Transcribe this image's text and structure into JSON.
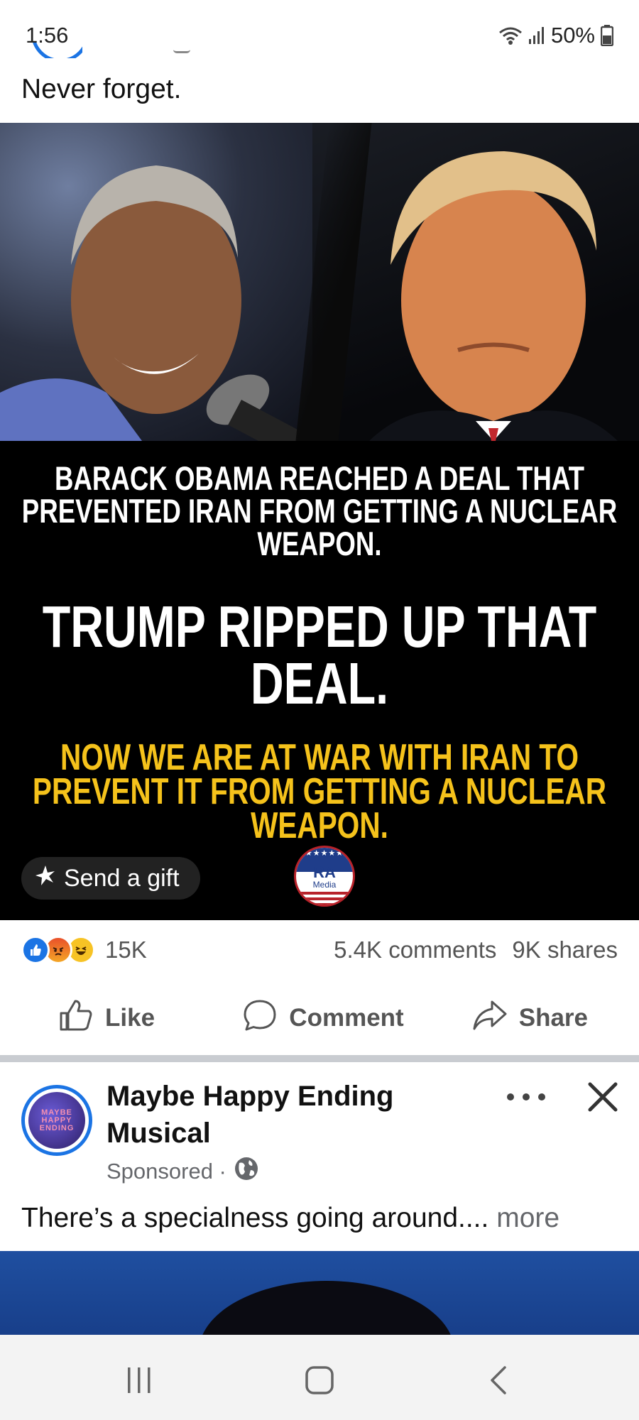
{
  "status_bar": {
    "time": "1:56",
    "battery": "50%"
  },
  "post": {
    "caption": "Never forget.",
    "image": {
      "headline_1": "BARACK OBAMA REACHED A DEAL THAT PREVENTED IRAN FROM GETTING A NUCLEAR WEAPON.",
      "headline_2": "TRUMP RIPPED UP THAT DEAL.",
      "headline_3": "NOW WE ARE AT WAR WITH IRAN TO PREVENT IT FROM GETTING A NUCLEAR WEAPON.",
      "logo_text": "RA",
      "logo_subtext": "Media",
      "logo_stars": "★★★★★"
    },
    "gift_button_label": "Send a gift",
    "reactions": [
      "like",
      "angry",
      "haha"
    ],
    "reaction_count": "15K",
    "comments_count": "5.4K comments",
    "shares_count": "9K shares",
    "actions": {
      "like": "Like",
      "comment": "Comment",
      "share": "Share"
    }
  },
  "sponsored_post": {
    "page_name": "Maybe Happy Ending Musical",
    "avatar_lines": [
      "MAYBE",
      "HAPPY",
      "ENDING"
    ],
    "meta": "Sponsored ·",
    "text": "There’s a specialness going around....",
    "more_label": "more"
  },
  "colors": {
    "brand_blue": "#1b74e4",
    "headline_yellow": "#f5c21b",
    "separator": "#c9ccd1"
  },
  "icons": {
    "status": [
      "wifi-icon",
      "signal-icon",
      "battery-icon"
    ],
    "actions": [
      "thumbs-up-icon",
      "comment-bubble-icon",
      "share-arrow-icon"
    ],
    "nav": [
      "recent-apps-icon",
      "home-icon",
      "back-icon"
    ]
  }
}
